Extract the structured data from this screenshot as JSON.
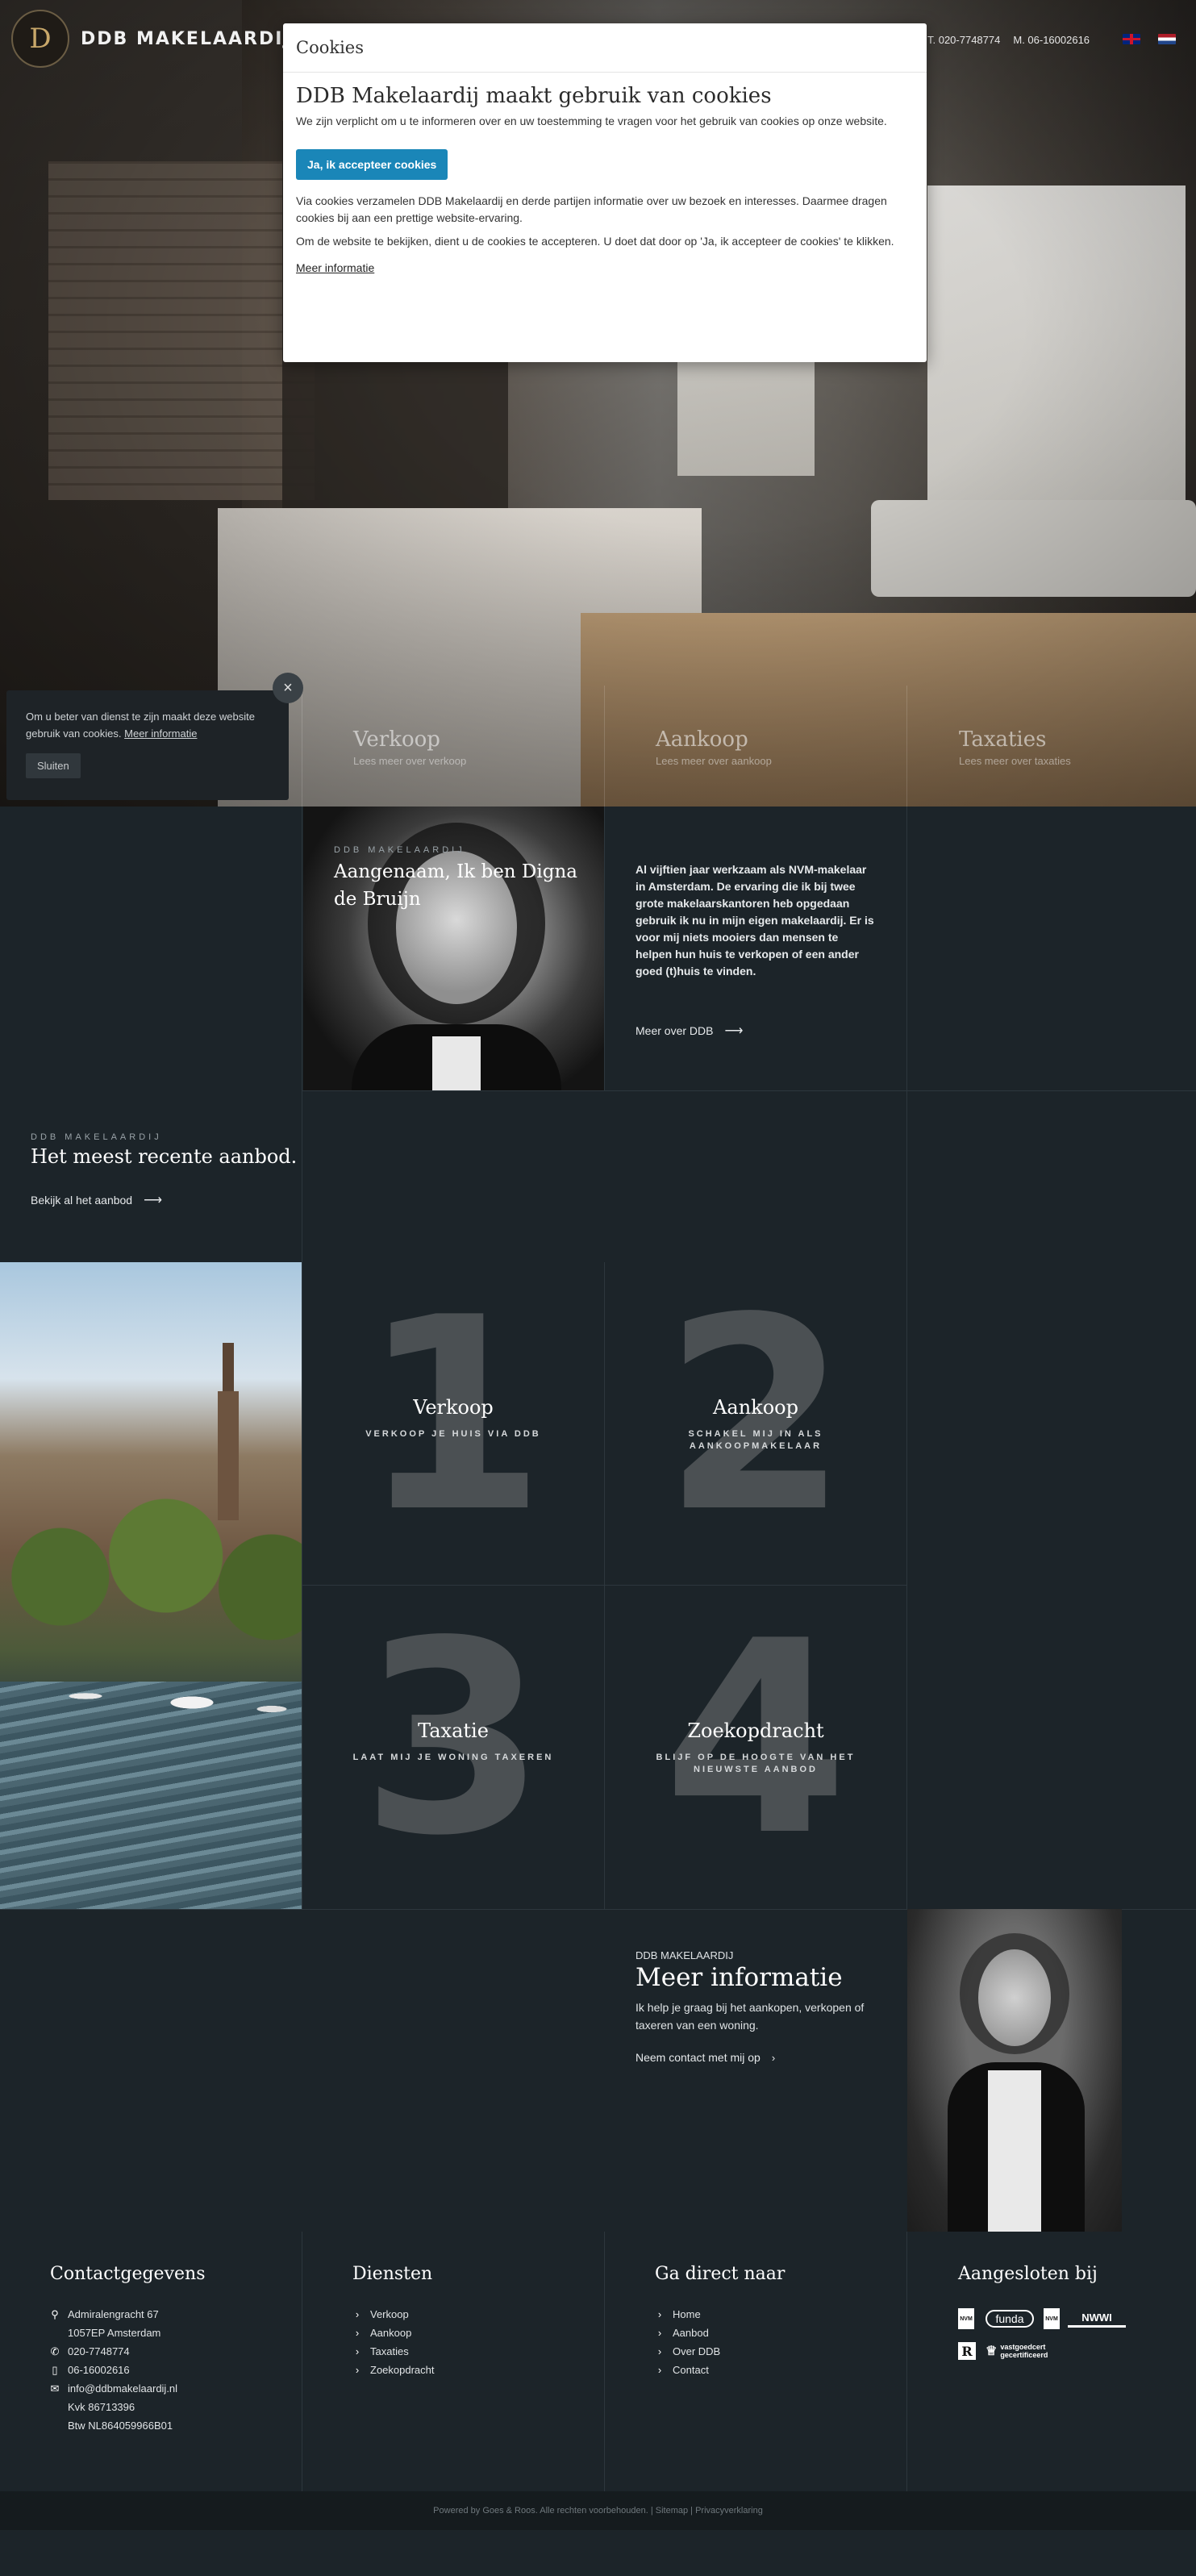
{
  "header": {
    "logo_text": "DDB MAKELAARDIJ",
    "logo_letter": "D",
    "phone_t": "T. 020-7748774",
    "phone_m": "M. 06-16002616"
  },
  "hero": {
    "links": [
      {
        "title": "Verkoop",
        "sub": "Lees meer over verkoop"
      },
      {
        "title": "Aankoop",
        "sub": "Lees meer over aankoop"
      },
      {
        "title": "Taxaties",
        "sub": "Lees meer over taxaties"
      }
    ]
  },
  "cookie_modal": {
    "header": "Cookies",
    "title": "DDB Makelaardij maakt gebruik van cookies",
    "intro": "We zijn verplicht om u te informeren over en uw toestemming te vragen voor het gebruik van cookies op onze website.",
    "accept_label": "Ja, ik accepteer cookies",
    "para1": "Via cookies verzamelen DDB Makelaardij en derde partijen informatie over uw bezoek en interesses. Daarmee dragen cookies bij aan een prettige website-ervaring.",
    "para2": "Om de website te bekijken, dient u de cookies te accepteren. U doet dat door op 'Ja, ik accepteer de cookies' te klikken.",
    "more_label": "Meer informatie"
  },
  "cookie_notice": {
    "text": "Om u beter van dienst te zijn maakt deze website gebruik van cookies.",
    "link": "Meer informatie",
    "close_label": "Sluiten",
    "close_icon": "×"
  },
  "intro": {
    "kicker": "DDB MAKELAARDIJ",
    "title": "Aangenaam, Ik ben Digna de Bruijn",
    "text": "Al vijftien jaar werkzaam als NVM-makelaar in Amsterdam. De ervaring die ik bij twee grote makelaarskantoren heb opgedaan gebruik ik nu in mijn eigen makelaardij. Er is voor mij niets mooiers dan mensen te helpen hun huis te verkopen of een ander goed (t)huis te vinden.",
    "link": "Meer over DDB"
  },
  "offer": {
    "kicker": "DDB MAKELAARDIJ",
    "title": "Het meest recente aanbod.",
    "link": "Bekijk al het aanbod"
  },
  "services": [
    {
      "digit": "1",
      "title": "Verkoop",
      "sub": "VERKOOP JE HUIS VIA DDB"
    },
    {
      "digit": "2",
      "title": "Aankoop",
      "sub": "SCHAKEL MIJ IN ALS AANKOOPMAKELAAR"
    },
    {
      "digit": "3",
      "title": "Taxatie",
      "sub": "LAAT MIJ JE WONING TAXEREN"
    },
    {
      "digit": "4",
      "title": "Zoekopdracht",
      "sub": "BLIJF OP DE HOOGTE VAN HET NIEUWSTE AANBOD"
    }
  ],
  "more_info": {
    "kicker": "DDB MAKELAARDIJ",
    "title": "Meer informatie",
    "text": "Ik help je graag bij het aankopen, verkopen of taxeren van een woning.",
    "link": "Neem contact met mij op"
  },
  "footer": {
    "contact": {
      "title": "Contactgegevens",
      "address1": "Admiralengracht 67",
      "address2": "1057EP Amsterdam",
      "phone": "020-7748774",
      "mobile": "06-16002616",
      "email": "info@ddbmakelaardij.nl",
      "kvk": "Kvk 86713396",
      "btw": "Btw NL864059966B01"
    },
    "services": {
      "title": "Diensten",
      "items": [
        "Verkoop",
        "Aankoop",
        "Taxaties",
        "Zoekopdracht"
      ]
    },
    "nav": {
      "title": "Ga direct naar",
      "items": [
        "Home",
        "Aanbod",
        "Over DDB",
        "Contact"
      ]
    },
    "member": {
      "title": "Aangesloten bij",
      "logos": [
        "NVM",
        "funda",
        "NVM",
        "NWWI",
        "R",
        "vastgoedcert gecertificeerd"
      ]
    },
    "copyright": "Powered by Goes & Roos. Alle rechten voorbehouden. | Sitemap | Privacyverklaring"
  },
  "colors": {
    "background": "#1c2429",
    "accent": "#1a86b8"
  }
}
